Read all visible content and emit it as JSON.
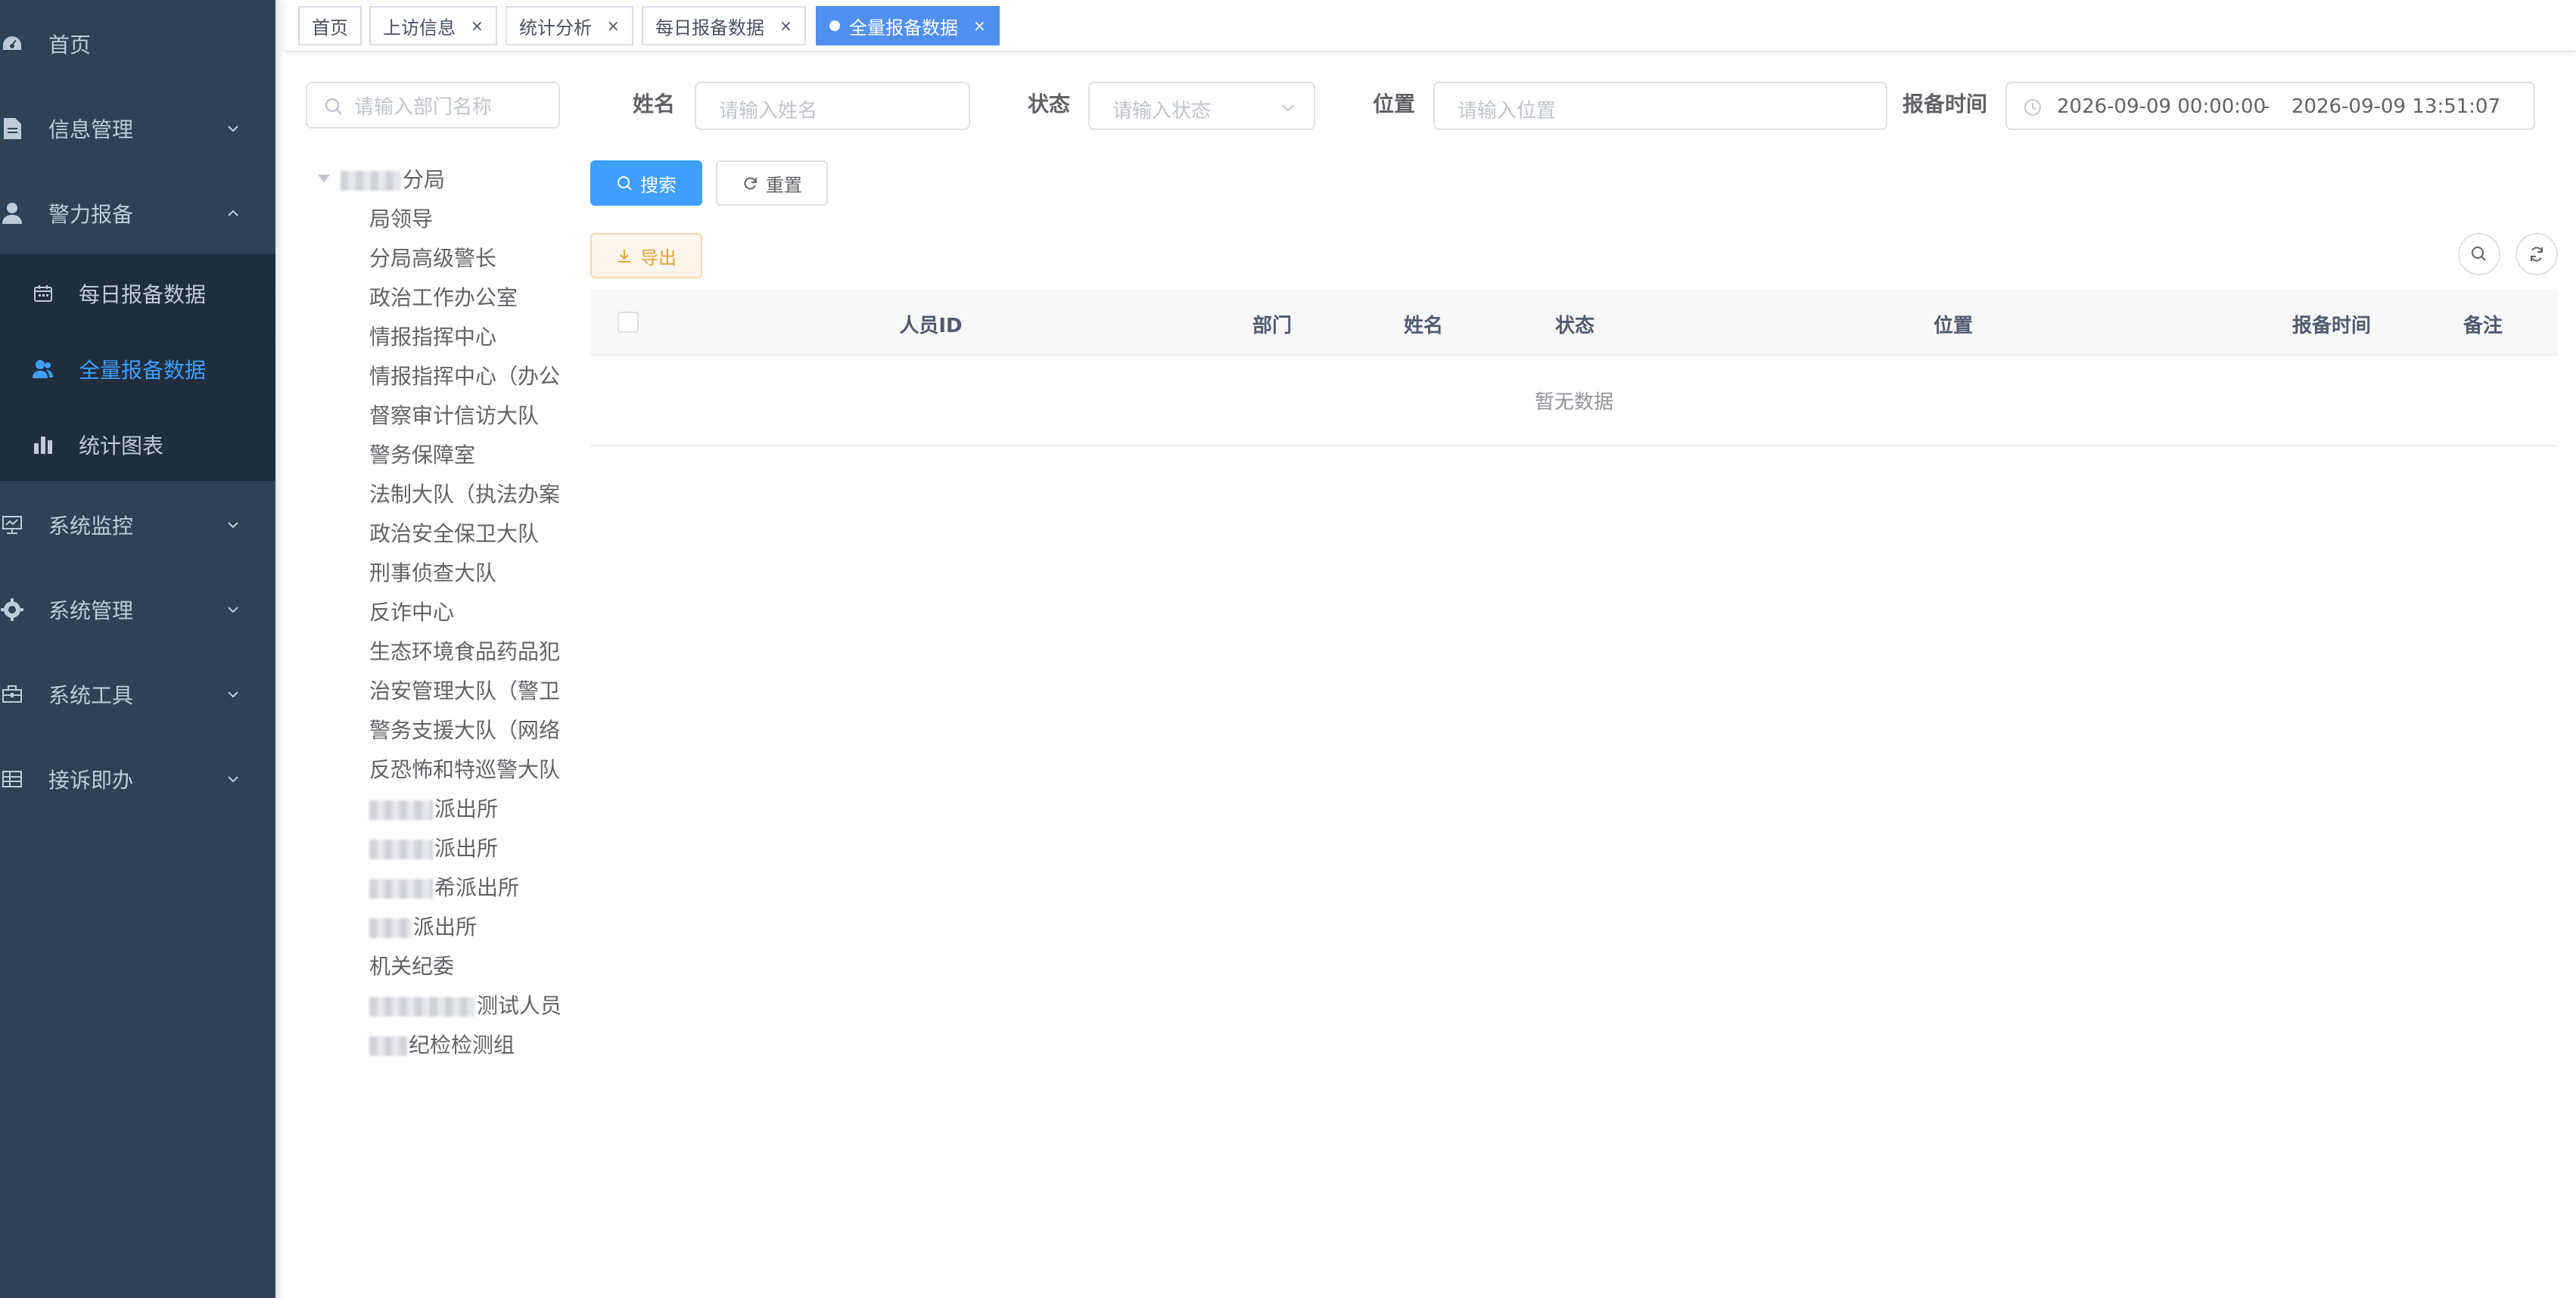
{
  "sidebar": {
    "items": [
      {
        "label": "首页",
        "icon": "dashboard-icon"
      },
      {
        "label": "信息管理",
        "icon": "document-icon"
      },
      {
        "label": "警力报备",
        "icon": "user-icon"
      },
      {
        "label": "系统监控",
        "icon": "monitor-icon"
      },
      {
        "label": "系统管理",
        "icon": "gear-icon"
      },
      {
        "label": "系统工具",
        "icon": "toolbox-icon"
      },
      {
        "label": "接诉即办",
        "icon": "table-icon"
      }
    ],
    "submenu": [
      {
        "label": "每日报备数据",
        "icon": "calendar-icon"
      },
      {
        "label": "全量报备数据",
        "icon": "peoples-icon",
        "active": true
      },
      {
        "label": "统计图表",
        "icon": "bar-chart-icon"
      }
    ],
    "background": "#304156",
    "submenu_background": "#1f2d3d",
    "active_color": "#409eff"
  },
  "tags": [
    {
      "label": "首页"
    },
    {
      "label": "上访信息",
      "close": "×"
    },
    {
      "label": "统计分析",
      "close": "×"
    },
    {
      "label": "每日报备数据",
      "close": "×"
    },
    {
      "label": "全量报备数据",
      "close": "×",
      "active": true
    }
  ],
  "dept_tree": {
    "search_placeholder": "请输入部门名称",
    "root": "分局",
    "children": [
      "局领导",
      "分局高级警长",
      "政治工作办公室",
      "情报指挥中心",
      "情报指挥中心（办公",
      "督察审计信访大队",
      "警务保障室",
      "法制大队（执法办案",
      "政治安全保卫大队",
      "刑事侦查大队",
      "反诈中心",
      "生态环境食品药品犯",
      "治安管理大队（警卫",
      "警务支援大队（网络",
      "反恐怖和特巡警大队",
      "派出所",
      "派出所",
      "希派出所",
      "派出所",
      "机关纪委",
      "测试人员",
      "纪检检测组"
    ]
  },
  "search_form": {
    "name_label": "姓名",
    "name_placeholder": "请输入姓名",
    "status_label": "状态",
    "status_placeholder": "请输入状态",
    "location_label": "位置",
    "location_placeholder": "请输入位置",
    "time_label": "报备时间",
    "time_start": "2026-09-09 00:00:00",
    "time_separator": "-",
    "time_end": "2026-09-09 13:51:07",
    "search_button": "搜索",
    "reset_button": "重置",
    "export_button": "导出"
  },
  "table": {
    "columns": [
      "人员ID",
      "部门",
      "姓名",
      "状态",
      "位置",
      "报备时间",
      "备注"
    ],
    "rows": [],
    "empty_text": "暂无数据"
  }
}
